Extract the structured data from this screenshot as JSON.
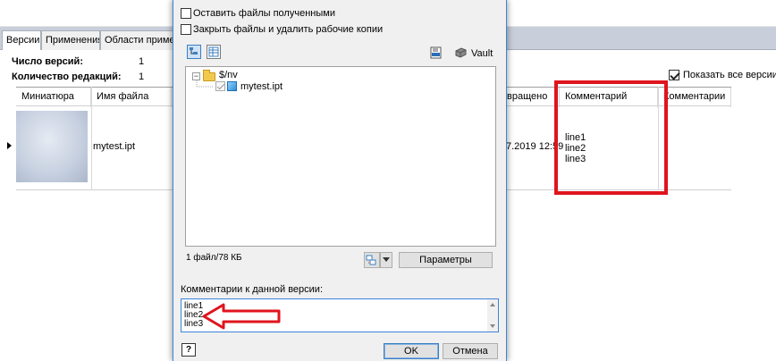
{
  "background": {
    "tabs": [
      {
        "label": "Версии",
        "active": true
      },
      {
        "label": "Применения",
        "active": false
      },
      {
        "label": "Области приме",
        "active": false
      }
    ],
    "stats": {
      "versions_label": "Число версий:",
      "versions_value": "1",
      "revisions_label": "Количество редакций:",
      "revisions_value": "1"
    },
    "show_all_versions": {
      "label": "Показать все версии",
      "checked": true
    },
    "grid": {
      "columns": [
        "Миниатюра",
        "Имя файла",
        "вращено",
        "Комментарий",
        "Комментарии"
      ],
      "row": {
        "file_name": "mytest.ipt",
        "date": "7.2019 12:59",
        "comment_lines": [
          "line1",
          "line2",
          "line3"
        ]
      }
    }
  },
  "dialog": {
    "keep_checked_out": {
      "label": "Оставить файлы полученными",
      "checked": false
    },
    "close_delete_copies": {
      "label": "Закрыть файлы и удалить рабочие копии",
      "checked": false
    },
    "toolbar": {
      "vault_label": "Vault"
    },
    "tree": {
      "root": "$/nv",
      "file": "mytest.ipt"
    },
    "status": "1 файл/78 КБ",
    "params_button": "Параметры",
    "comments_label": "Комментарии к данной версии:",
    "comments_lines": [
      "line1",
      "line2",
      "line3"
    ],
    "ok_button": "OK",
    "cancel_button": "Отмена",
    "help_button": "?"
  },
  "colors": {
    "annotation_red": "#e0141e",
    "dialog_border": "#3c84d8"
  }
}
